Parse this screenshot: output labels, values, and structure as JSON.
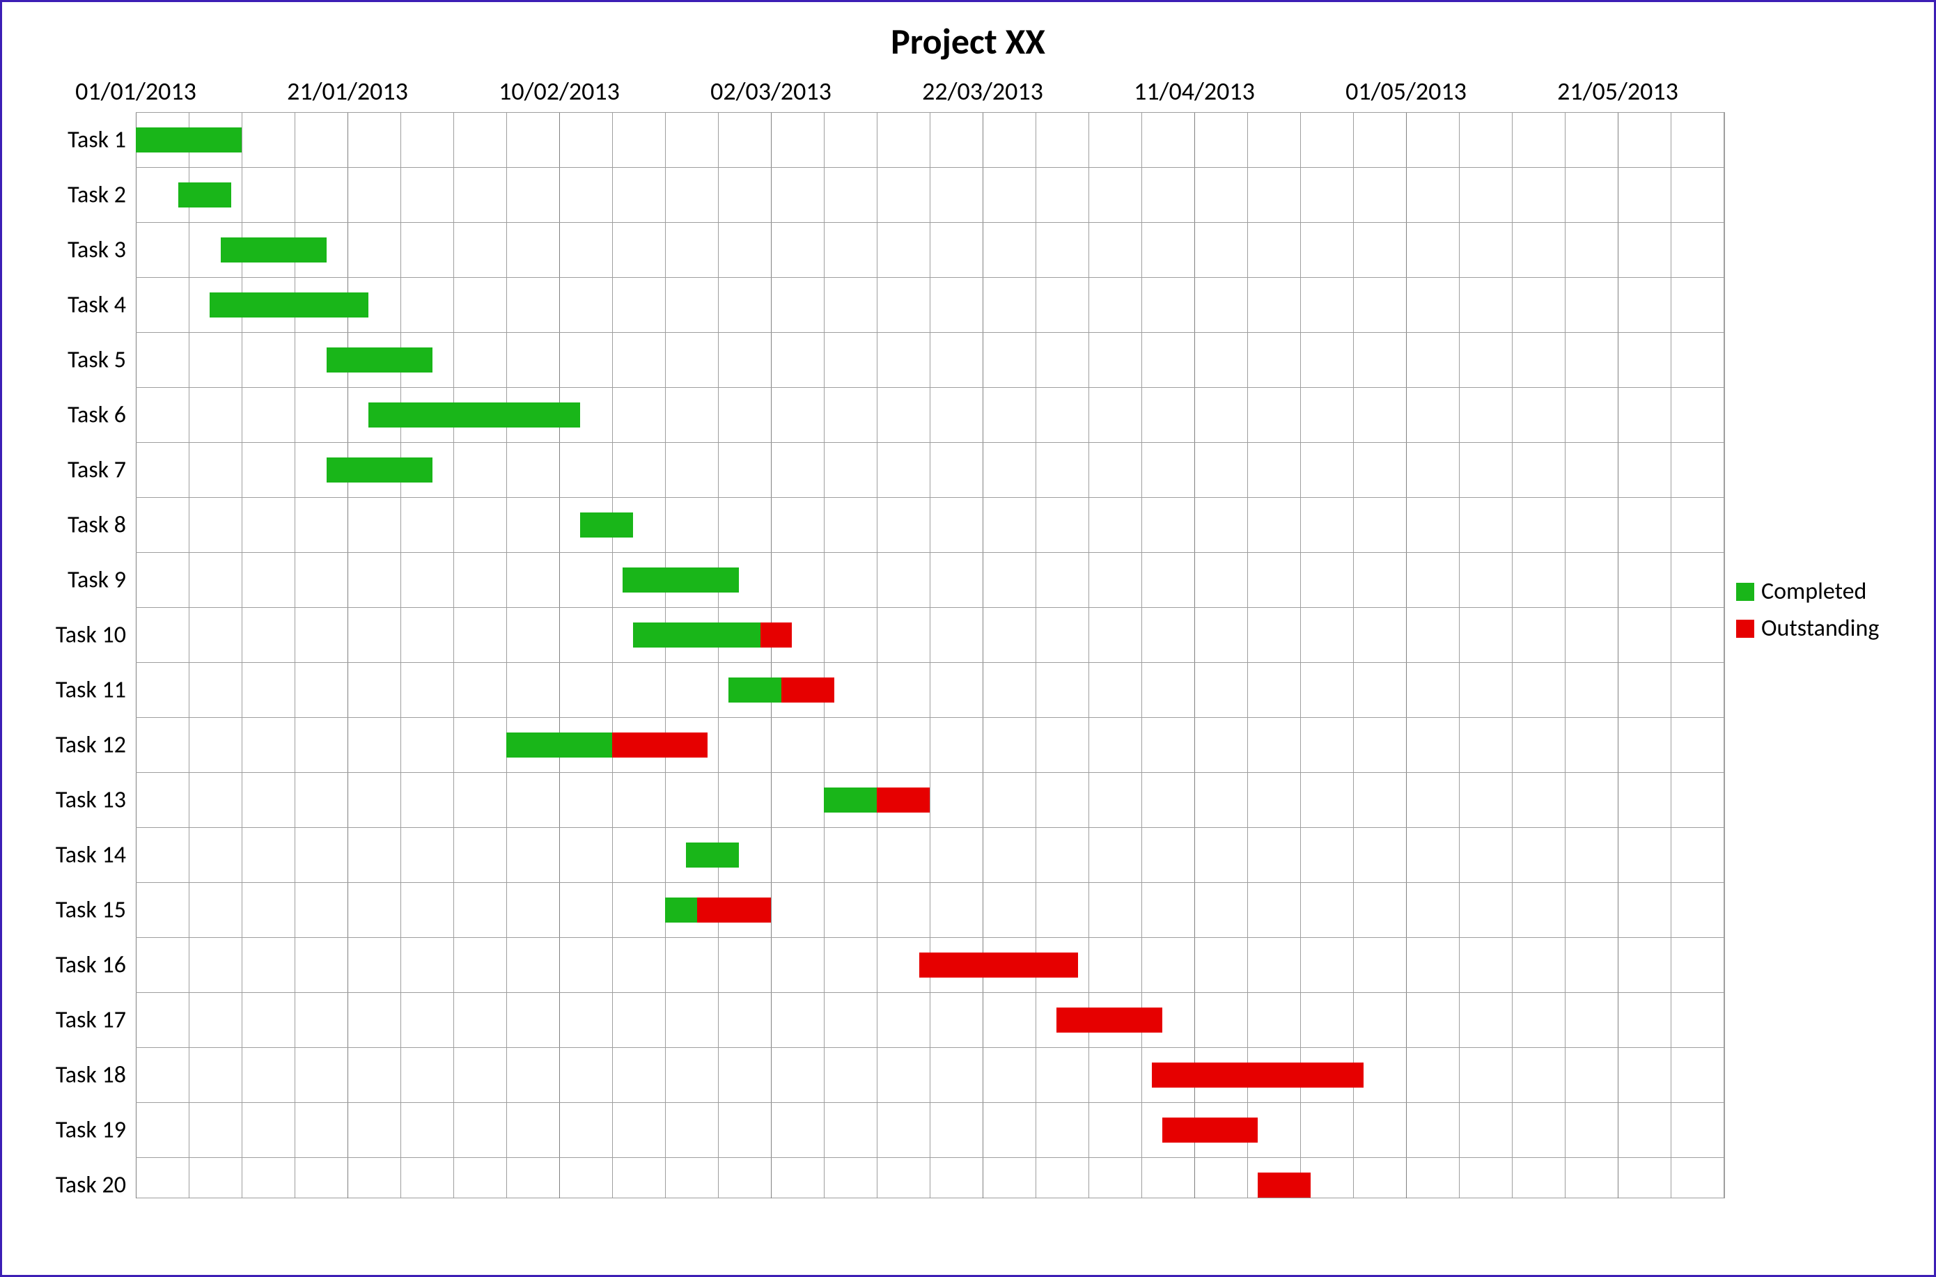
{
  "legend": {
    "completed": "Completed",
    "outstanding": "Outstanding"
  },
  "chart_data": {
    "type": "bar",
    "title": "Project XX",
    "xlabel": "",
    "ylabel": "",
    "x_tick_labels": [
      "01/01/2013",
      "21/01/2013",
      "10/02/2013",
      "02/03/2013",
      "22/03/2013",
      "11/04/2013",
      "01/05/2013",
      "21/05/2013"
    ],
    "x_range_days": [
      0,
      150
    ],
    "x_major_ticks_days": [
      0,
      20,
      40,
      60,
      80,
      100,
      120,
      140
    ],
    "x_minor_ticks_days": [
      5,
      10,
      15,
      25,
      30,
      35,
      45,
      50,
      55,
      65,
      70,
      75,
      85,
      90,
      95,
      105,
      110,
      115,
      125,
      130,
      135,
      145,
      150
    ],
    "categories": [
      "Task 1",
      "Task 2",
      "Task 3",
      "Task 4",
      "Task 5",
      "Task 6",
      "Task 7",
      "Task 8",
      "Task 9",
      "Task 10",
      "Task 11",
      "Task 12",
      "Task 13",
      "Task 14",
      "Task 15",
      "Task 16",
      "Task 17",
      "Task 18",
      "Task 19",
      "Task 20"
    ],
    "series": [
      {
        "name": "Completed",
        "color": "#19b619"
      },
      {
        "name": "Outstanding",
        "color": "#e60000"
      }
    ],
    "tasks": [
      {
        "name": "Task 1",
        "start_day": 0,
        "completed_days": 10,
        "outstanding_days": 0
      },
      {
        "name": "Task 2",
        "start_day": 4,
        "completed_days": 5,
        "outstanding_days": 0
      },
      {
        "name": "Task 3",
        "start_day": 8,
        "completed_days": 10,
        "outstanding_days": 0
      },
      {
        "name": "Task 4",
        "start_day": 7,
        "completed_days": 15,
        "outstanding_days": 0
      },
      {
        "name": "Task 5",
        "start_day": 18,
        "completed_days": 10,
        "outstanding_days": 0
      },
      {
        "name": "Task 6",
        "start_day": 22,
        "completed_days": 20,
        "outstanding_days": 0
      },
      {
        "name": "Task 7",
        "start_day": 18,
        "completed_days": 10,
        "outstanding_days": 0
      },
      {
        "name": "Task 8",
        "start_day": 42,
        "completed_days": 5,
        "outstanding_days": 0
      },
      {
        "name": "Task 9",
        "start_day": 46,
        "completed_days": 11,
        "outstanding_days": 0
      },
      {
        "name": "Task 10",
        "start_day": 47,
        "completed_days": 12,
        "outstanding_days": 3
      },
      {
        "name": "Task 11",
        "start_day": 56,
        "completed_days": 5,
        "outstanding_days": 5
      },
      {
        "name": "Task 12",
        "start_day": 35,
        "completed_days": 10,
        "outstanding_days": 9
      },
      {
        "name": "Task 13",
        "start_day": 65,
        "completed_days": 5,
        "outstanding_days": 5
      },
      {
        "name": "Task 14",
        "start_day": 52,
        "completed_days": 5,
        "outstanding_days": 0
      },
      {
        "name": "Task 15",
        "start_day": 50,
        "completed_days": 3,
        "outstanding_days": 7
      },
      {
        "name": "Task 16",
        "start_day": 74,
        "completed_days": 0,
        "outstanding_days": 15
      },
      {
        "name": "Task 17",
        "start_day": 87,
        "completed_days": 0,
        "outstanding_days": 10
      },
      {
        "name": "Task 18",
        "start_day": 96,
        "completed_days": 0,
        "outstanding_days": 20
      },
      {
        "name": "Task 19",
        "start_day": 97,
        "completed_days": 0,
        "outstanding_days": 9
      },
      {
        "name": "Task 20",
        "start_day": 106,
        "completed_days": 0,
        "outstanding_days": 5
      }
    ]
  }
}
